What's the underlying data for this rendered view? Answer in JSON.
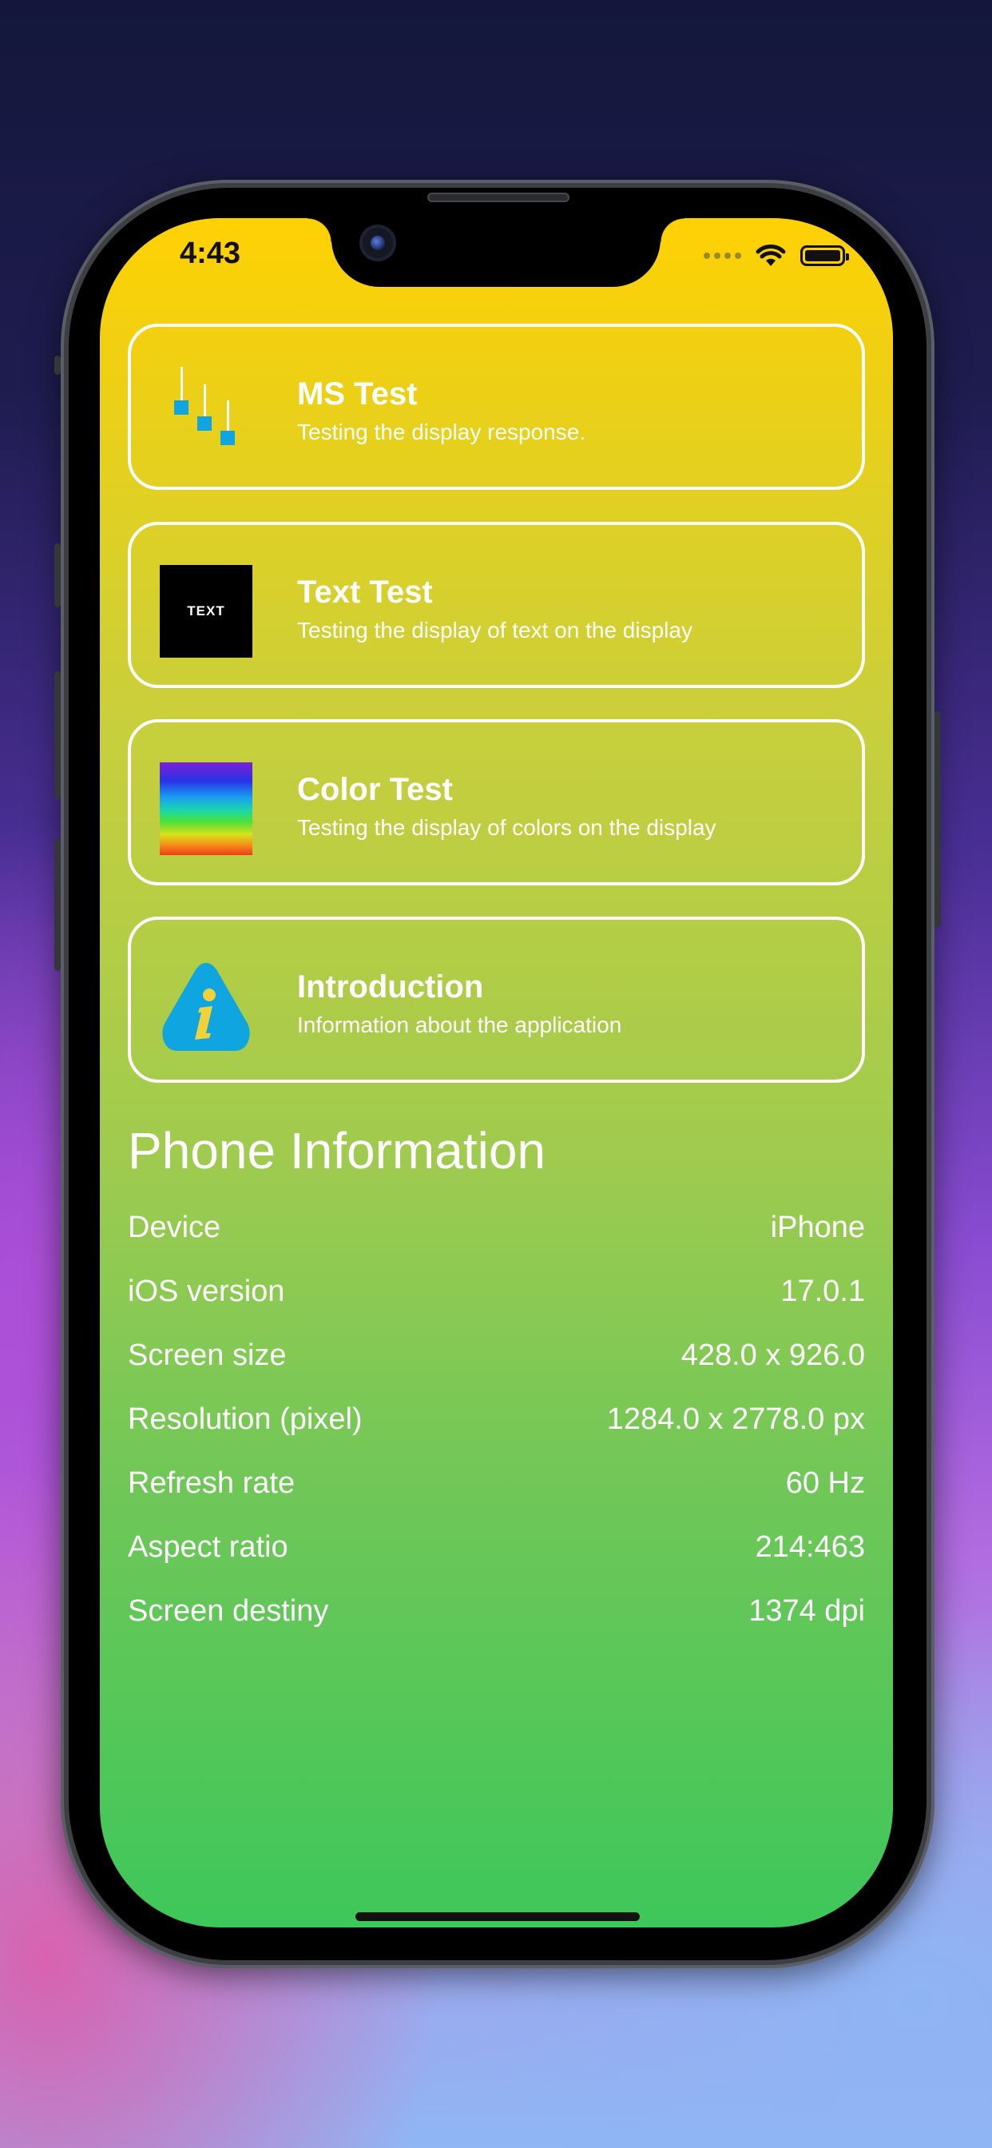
{
  "status_bar": {
    "time": "4:43"
  },
  "cards": [
    {
      "title": "MS Test",
      "subtitle": "Testing the display response.",
      "icon": "ms-test-icon"
    },
    {
      "title": "Text Test",
      "subtitle": "Testing the display of text on the display",
      "icon": "text-test-icon",
      "icon_label": "TEXT"
    },
    {
      "title": "Color Test",
      "subtitle": "Testing the display of colors on the display",
      "icon": "color-test-icon"
    },
    {
      "title": "Introduction",
      "subtitle": "Information about the application",
      "icon": "info-icon"
    }
  ],
  "phone_info": {
    "title": "Phone Information",
    "rows": [
      {
        "label": "Device",
        "value": "iPhone"
      },
      {
        "label": "iOS version",
        "value": "17.0.1"
      },
      {
        "label": "Screen size",
        "value": "428.0 x 926.0"
      },
      {
        "label": "Resolution (pixel)",
        "value": "1284.0 x 2778.0 px"
      },
      {
        "label": "Refresh rate",
        "value": "60 Hz"
      },
      {
        "label": "Aspect ratio",
        "value": "214:463"
      },
      {
        "label": "Screen destiny",
        "value": "1374 dpi"
      }
    ]
  },
  "colors": {
    "gradient_top": "#ffd103",
    "gradient_bottom": "#3ec75a",
    "accent_blue": "#0ea5e0"
  }
}
